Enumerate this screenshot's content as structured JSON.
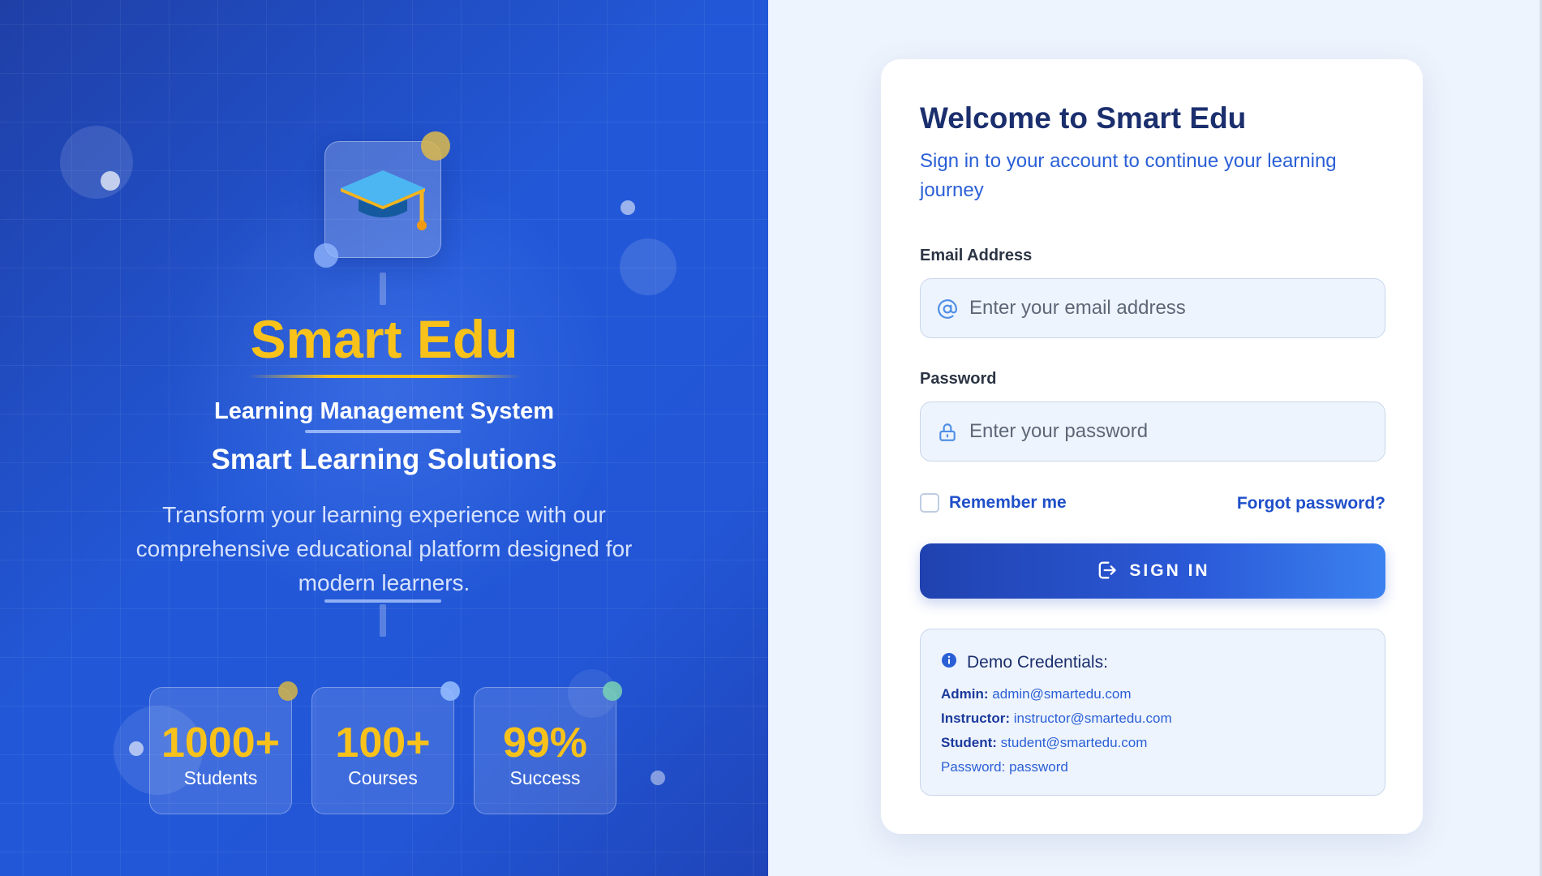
{
  "brand": {
    "title": "Smart Edu",
    "subtitle": "Learning Management System",
    "tagline": "Smart Learning Solutions",
    "description": "Transform your learning experience with our comprehensive educational platform designed for modern learners.",
    "logo_icon": "graduation-cap-icon",
    "accent_color": "#f8c21a"
  },
  "stats": [
    {
      "value": "1000+",
      "label": "Students"
    },
    {
      "value": "100+",
      "label": "Courses"
    },
    {
      "value": "99%",
      "label": "Success"
    }
  ],
  "login": {
    "title": "Welcome to Smart Edu",
    "subtitle": "Sign in to your account to continue your learning journey",
    "email_label": "Email Address",
    "email_placeholder": "Enter your email address",
    "email_value": "",
    "password_label": "Password",
    "password_placeholder": "Enter your password",
    "password_value": "",
    "remember_label": "Remember me",
    "remember_checked": false,
    "forgot_label": "Forgot password?",
    "signin_label": "SIGN IN",
    "primary_color": "#2b5ad8"
  },
  "demo": {
    "title": "Demo Credentials:",
    "lines": [
      {
        "key": "Admin:",
        "value": "admin@smartedu.com"
      },
      {
        "key": "Instructor:",
        "value": "instructor@smartedu.com"
      },
      {
        "key": "Student:",
        "value": "student@smartedu.com"
      },
      {
        "key": "",
        "value": "Password: password"
      }
    ]
  }
}
